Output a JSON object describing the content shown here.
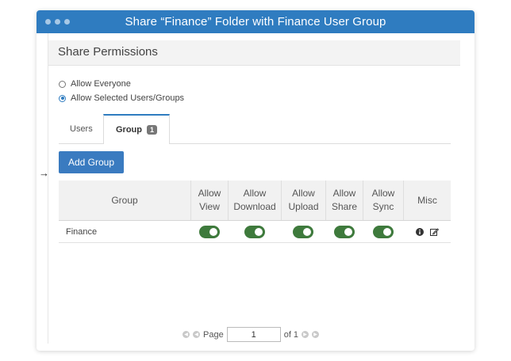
{
  "window": {
    "title": "Share “Finance” Folder with Finance User Group"
  },
  "panel": {
    "title": "Share Permissions"
  },
  "radios": [
    {
      "label": "Allow Everyone",
      "checked": false
    },
    {
      "label": "Allow Selected Users/Groups",
      "checked": true
    }
  ],
  "tabs": {
    "users": "Users",
    "group": "Group",
    "group_count": "1"
  },
  "buttons": {
    "add_group": "Add Group"
  },
  "pointer": "→",
  "grid": {
    "headers": [
      {
        "line1": "Group",
        "line2": ""
      },
      {
        "line1": "Allow",
        "line2": "View"
      },
      {
        "line1": "Allow",
        "line2": "Download"
      },
      {
        "line1": "Allow",
        "line2": "Upload"
      },
      {
        "line1": "Allow",
        "line2": "Share"
      },
      {
        "line1": "Allow",
        "line2": "Sync"
      },
      {
        "line1": "Misc",
        "line2": ""
      }
    ],
    "rows": [
      {
        "name": "Finance",
        "view": true,
        "download": true,
        "upload": true,
        "share": true,
        "sync": true
      }
    ]
  },
  "pager": {
    "page_label": "Page",
    "page_value": "1",
    "of_label": "of 1"
  },
  "colors": {
    "titlebar": "#2f7cc0",
    "toggle_on": "#3e7a3c",
    "button": "#3a7bc0"
  }
}
